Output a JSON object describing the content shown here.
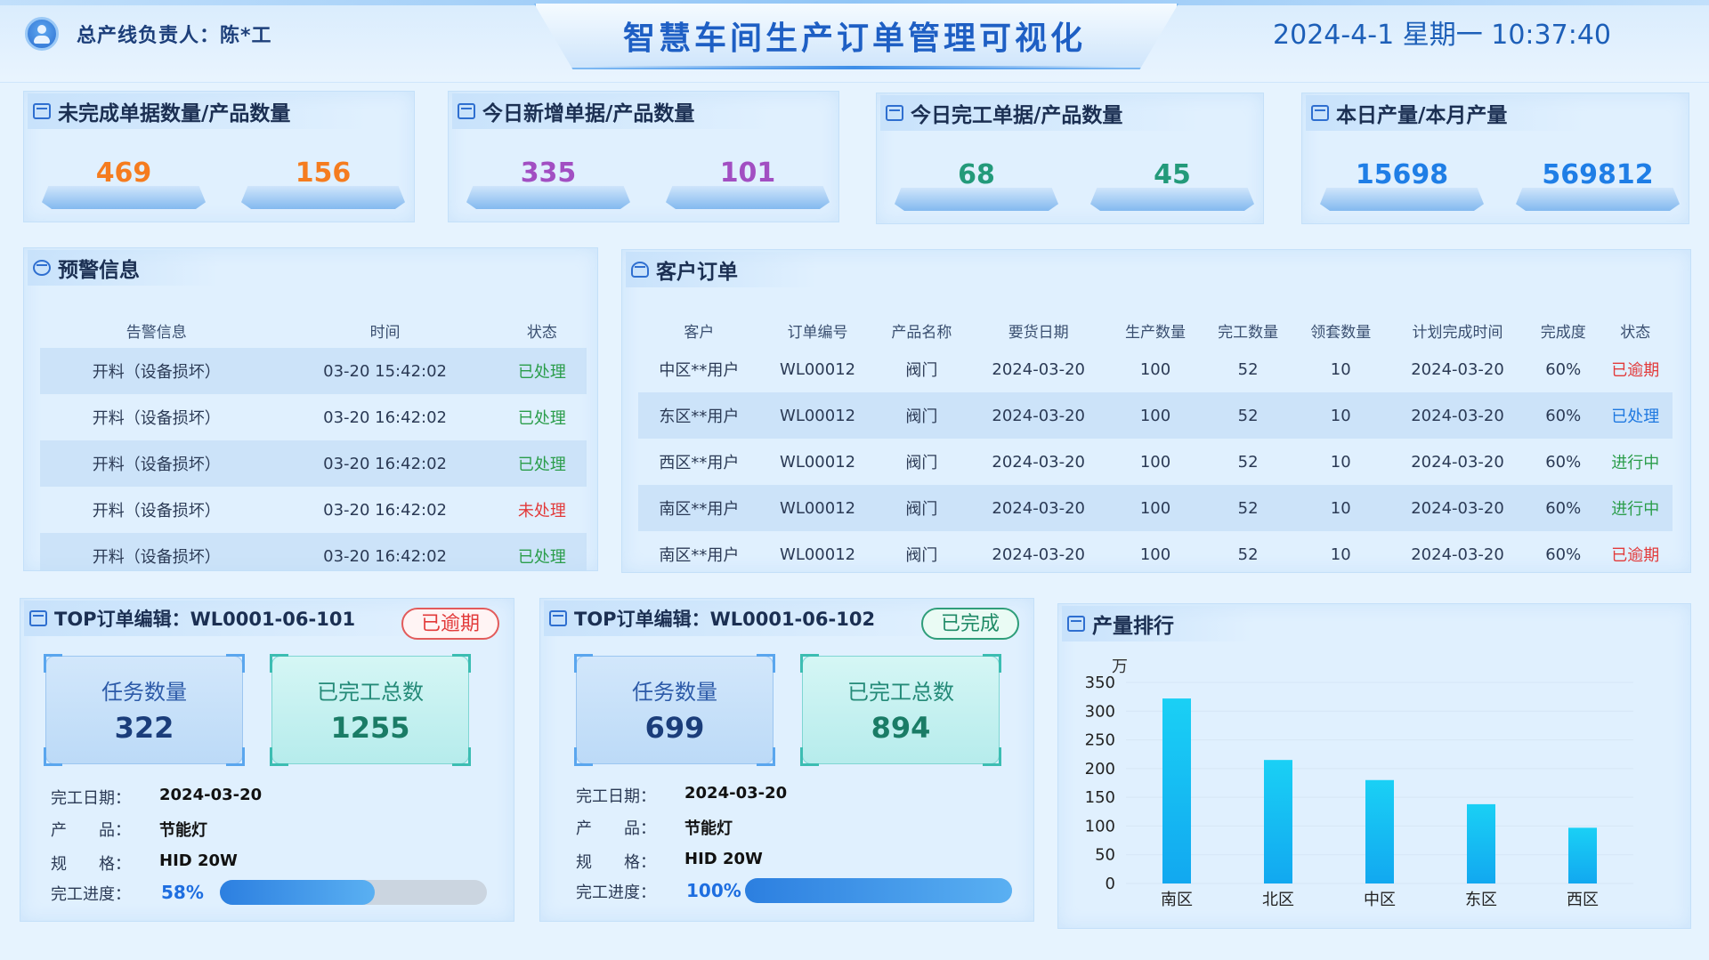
{
  "header": {
    "manager": "总产线负责人：陈*工",
    "title": "智慧车间生产订单管理可视化",
    "datetime": "2024-4-1 星期一 10:37:40"
  },
  "stats": [
    {
      "title": "未完成单据数量/产品数量",
      "values": [
        "469",
        "156"
      ],
      "color": "#f57c1f"
    },
    {
      "title": "今日新增单据/产品数量",
      "values": [
        "335",
        "101"
      ],
      "color": "#a24fc2"
    },
    {
      "title": "今日完工单据/产品数量",
      "values": [
        "68",
        "45"
      ],
      "color": "#239a7a"
    },
    {
      "title": "本日产量/本月产量",
      "values": [
        "15698",
        "569812"
      ],
      "color": "#1f7ee6"
    }
  ],
  "warnings": {
    "title": "预警信息",
    "columns": [
      "告警信息",
      "时间",
      "状态"
    ],
    "rows": [
      {
        "info": "开料（设备损坏）",
        "time": "03-20 15:42:02",
        "status": "已处理",
        "status_color": "#2a9d4a"
      },
      {
        "info": "开料（设备损坏）",
        "time": "03-20 16:42:02",
        "status": "已处理",
        "status_color": "#2a9d4a"
      },
      {
        "info": "开料（设备损坏）",
        "time": "03-20 16:42:02",
        "status": "已处理",
        "status_color": "#2a9d4a"
      },
      {
        "info": "开料（设备损坏）",
        "time": "03-20 16:42:02",
        "status": "未处理",
        "status_color": "#e23a3a"
      },
      {
        "info": "开料（设备损坏）",
        "time": "03-20 16:42:02",
        "status": "已处理",
        "status_color": "#2a9d4a"
      }
    ]
  },
  "orders": {
    "title": "客户订单",
    "columns": [
      "客户",
      "订单编号",
      "产品名称",
      "要货日期",
      "生产数量",
      "完工数量",
      "领套数量",
      "计划完成时间",
      "完成度",
      "状态"
    ],
    "rows": [
      {
        "cells": [
          "中区**用户",
          "WL00012",
          "阀门",
          "2024-03-20",
          "100",
          "52",
          "10",
          "2024-03-20",
          "60%"
        ],
        "status": "已逾期",
        "status_color": "#e23a3a"
      },
      {
        "cells": [
          "东区**用户",
          "WL00012",
          "阀门",
          "2024-03-20",
          "100",
          "52",
          "10",
          "2024-03-20",
          "60%"
        ],
        "status": "已处理",
        "status_color": "#1e78e0"
      },
      {
        "cells": [
          "西区**用户",
          "WL00012",
          "阀门",
          "2024-03-20",
          "100",
          "52",
          "10",
          "2024-03-20",
          "60%"
        ],
        "status": "进行中",
        "status_color": "#2a9d4a"
      },
      {
        "cells": [
          "南区**用户",
          "WL00012",
          "阀门",
          "2024-03-20",
          "100",
          "52",
          "10",
          "2024-03-20",
          "60%"
        ],
        "status": "进行中",
        "status_color": "#2a9d4a"
      },
      {
        "cells": [
          "南区**用户",
          "WL00012",
          "阀门",
          "2024-03-20",
          "100",
          "52",
          "10",
          "2024-03-20",
          "60%"
        ],
        "status": "已逾期",
        "status_color": "#e23a3a"
      }
    ]
  },
  "top_orders": [
    {
      "title": "TOP订单编辑：WL0001-06-101",
      "tag": "已逾期",
      "tag_style": "red",
      "task_label": "任务数量",
      "task_value": "322",
      "done_label": "已完工总数",
      "done_value": "1255",
      "date_label": "完工日期：",
      "date": "2024-03-20",
      "product_label": "产　　品：",
      "product": "节能灯",
      "spec_label": "规　　格：",
      "spec": "HID 20W",
      "progress_label": "完工进度：",
      "progress_text": "58%",
      "progress": 0.58
    },
    {
      "title": "TOP订单编辑：WL0001-06-102",
      "tag": "已完成",
      "tag_style": "green",
      "task_label": "任务数量",
      "task_value": "699",
      "done_label": "已完工总数",
      "done_value": "894",
      "date_label": "完工日期：",
      "date": "2024-03-20",
      "product_label": "产　　品：",
      "product": "节能灯",
      "spec_label": "规　　格：",
      "spec": "HID 20W",
      "progress_label": "完工进度：",
      "progress_text": "100%",
      "progress": 1.0
    }
  ],
  "ranking": {
    "title": "产量排行"
  },
  "chart_data": {
    "type": "bar",
    "title": "",
    "ylabel": "万",
    "xlabel": "",
    "categories": [
      "南区",
      "北区",
      "中区",
      "东区",
      "西区"
    ],
    "values": [
      322,
      215,
      180,
      138,
      97
    ],
    "ylim": [
      0,
      350
    ],
    "yticks": [
      0,
      50,
      100,
      150,
      200,
      250,
      300,
      350
    ],
    "grid": true,
    "bar_color": "#12a8f0"
  }
}
